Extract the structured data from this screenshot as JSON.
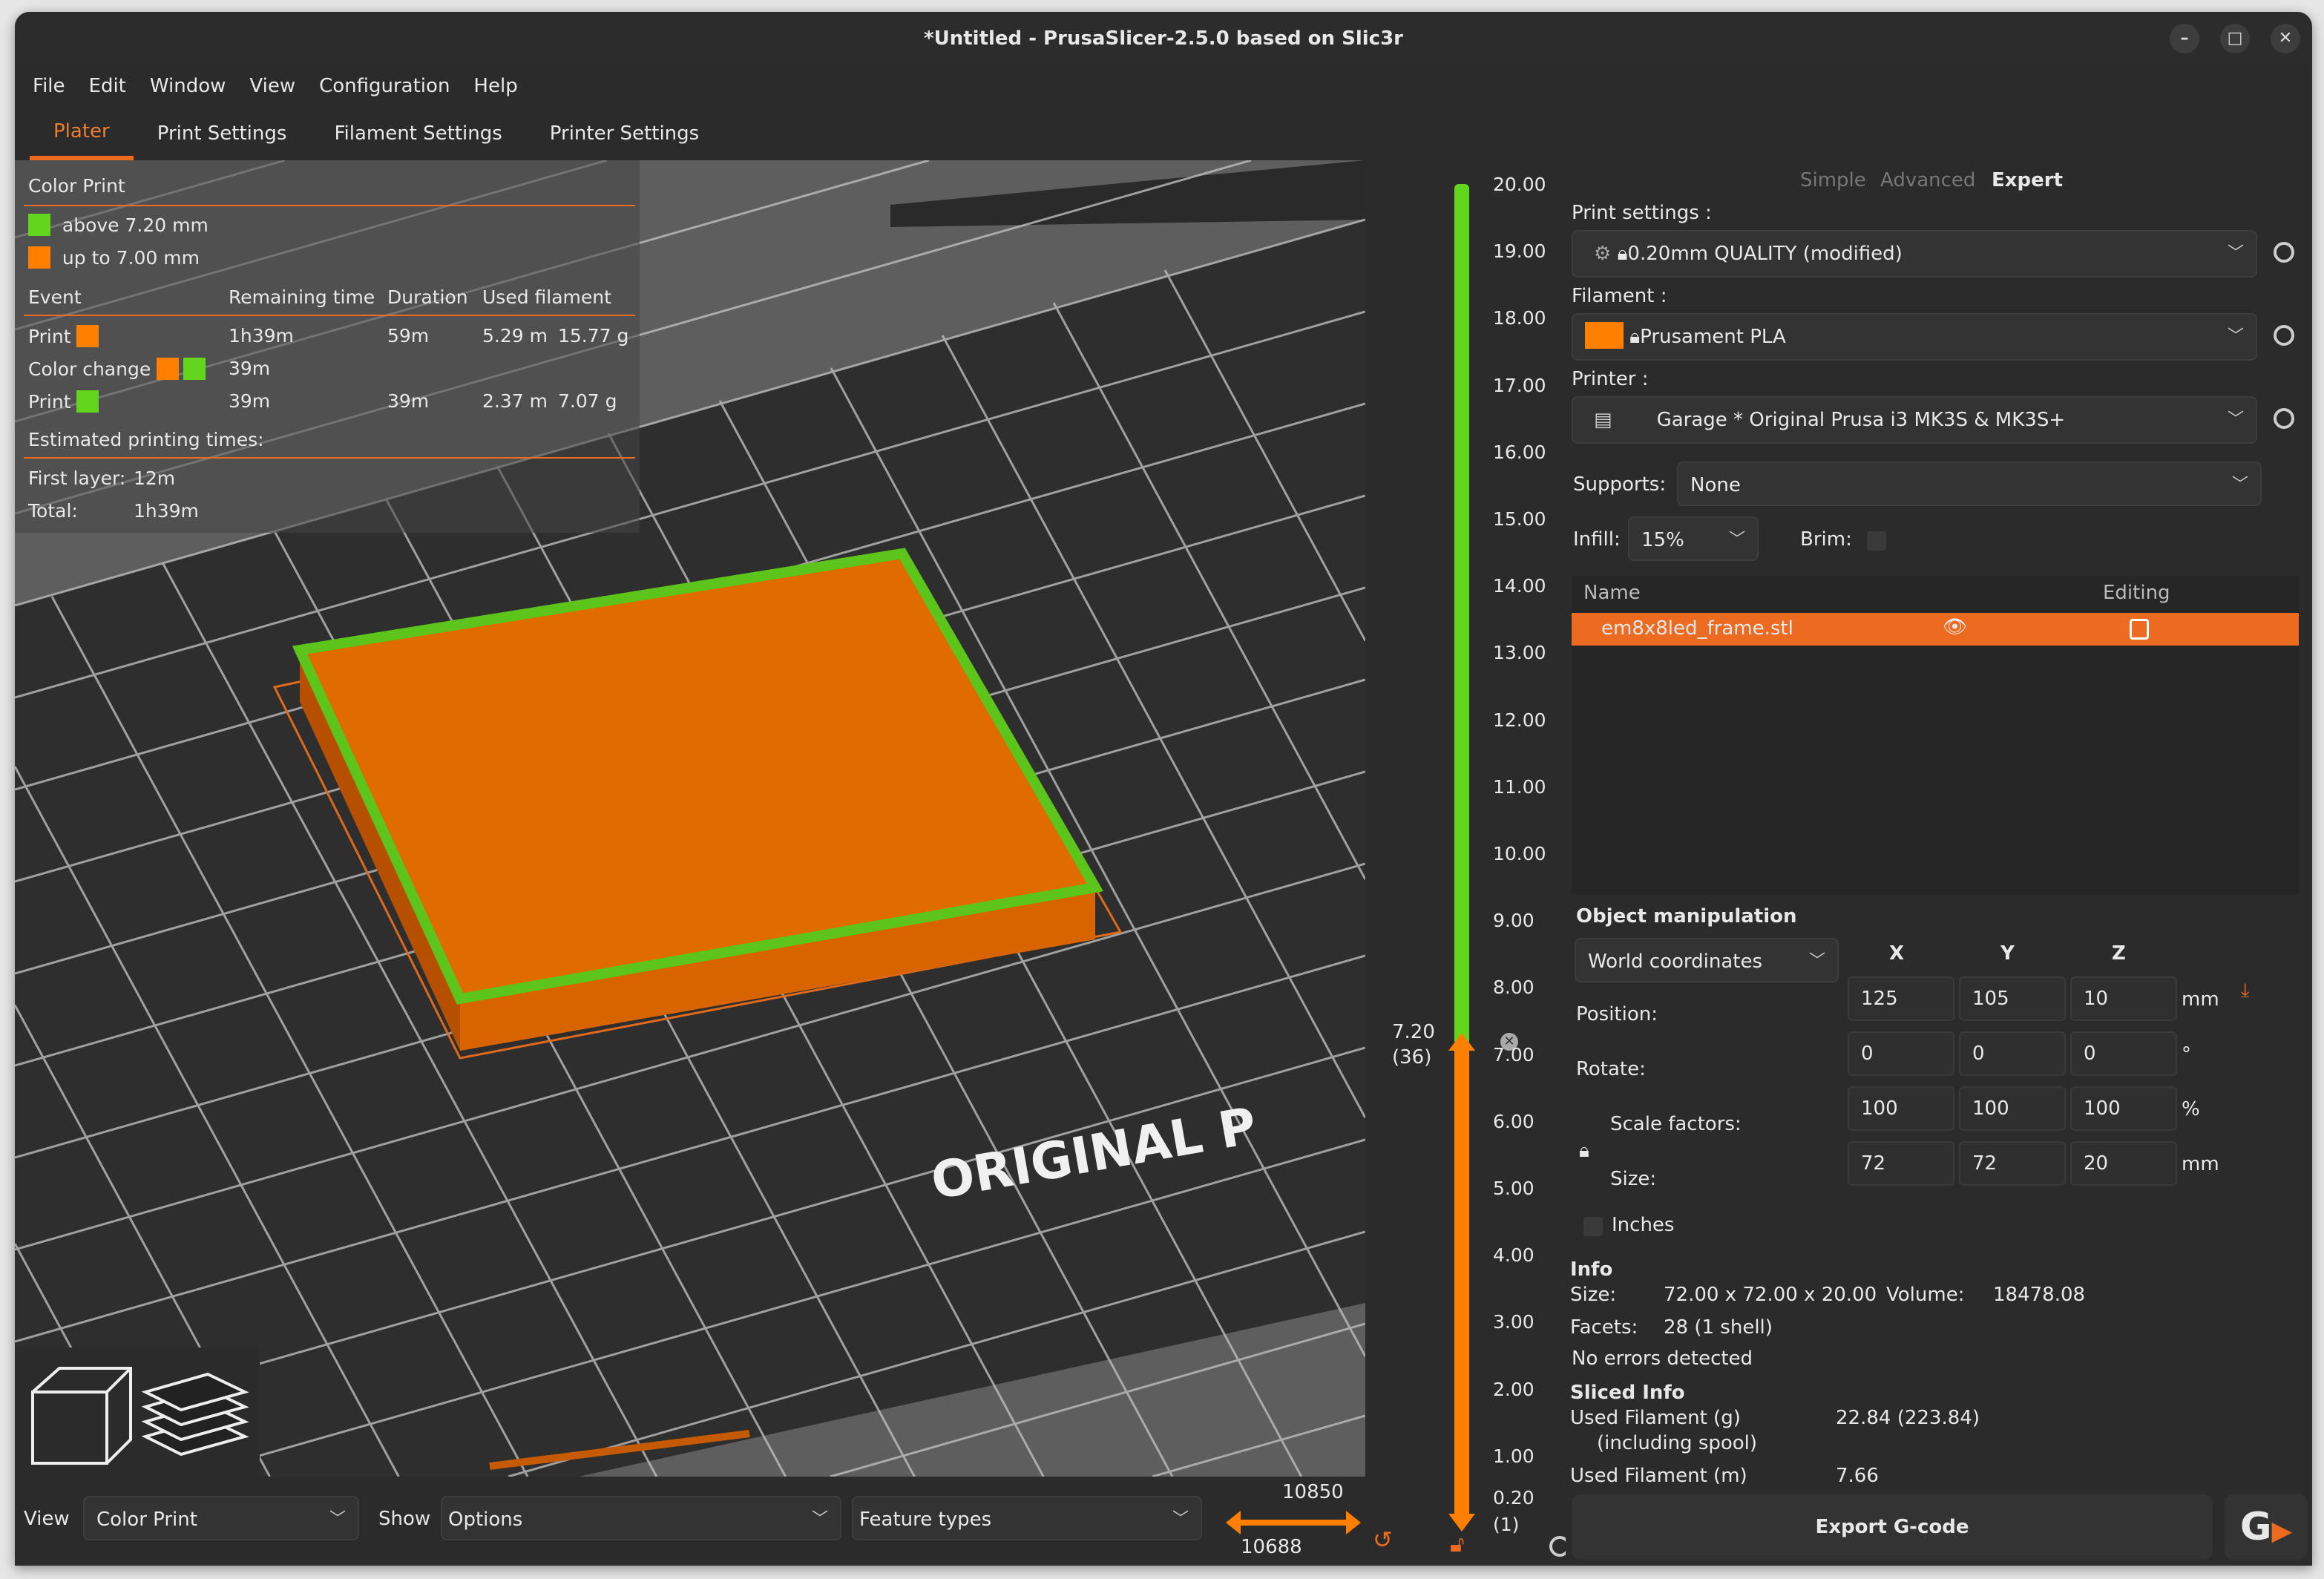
{
  "window": {
    "title": "*Untitled - PrusaSlicer-2.5.0 based on Slic3r",
    "minimize": "–",
    "maximize": "□",
    "close": "✕"
  },
  "menu": [
    "File",
    "Edit",
    "Window",
    "View",
    "Configuration",
    "Help"
  ],
  "tabs": [
    "Plater",
    "Print Settings",
    "Filament Settings",
    "Printer Settings"
  ],
  "legend": {
    "title": "Color Print",
    "items": [
      {
        "label": "above 7.20 mm",
        "color": "#63d51c"
      },
      {
        "label": "up to 7.00 mm",
        "color": "#ff7f00"
      }
    ],
    "headers": [
      "Event",
      "Remaining time",
      "Duration",
      "Used filament"
    ],
    "rows": [
      {
        "event": "Print",
        "remaining": "1h39m",
        "duration": "59m",
        "length": "5.29 m",
        "weight": "15.77 g"
      },
      {
        "event": "Color change",
        "remaining": "39m"
      },
      {
        "event": "Print",
        "remaining": "39m",
        "duration": "39m",
        "length": "2.37 m",
        "weight": "7.07 g"
      }
    ],
    "estimated_title": "Estimated printing times:",
    "first_layer_label": "First layer:",
    "first_layer": "12m",
    "total_label": "Total:",
    "total": "1h39m"
  },
  "bed_text": "ORIGINAL P",
  "layer_slider": {
    "ticks": [
      "20.00",
      "19.00",
      "18.00",
      "17.00",
      "16.00",
      "15.00",
      "14.00",
      "13.00",
      "12.00",
      "11.00",
      "10.00",
      "9.00",
      "8.00",
      "7.00",
      "6.00",
      "5.00",
      "4.00",
      "3.00",
      "2.00",
      "1.00",
      "0.20"
    ],
    "current": "7.20",
    "current_layer": "(36)",
    "bottom_layer": "(1)",
    "upper_color": "#63d51c",
    "lower_color": "#ff7f00"
  },
  "bottom": {
    "view_label": "View",
    "view_value": "Color Print",
    "show_label": "Show",
    "show_value": "Options",
    "feature_value": "Feature types",
    "moves_top": "10850",
    "moves_bottom": "10688"
  },
  "panel": {
    "modes": [
      "Simple",
      "Advanced",
      "Expert"
    ],
    "print_label": "Print settings :",
    "print_value": "0.20mm QUALITY (modified)",
    "filament_label": "Filament :",
    "filament_value": "Prusament PLA",
    "filament_color": "#ff7f00",
    "printer_label": "Printer :",
    "printer_value": "Garage * Original Prusa i3 MK3S & MK3S+",
    "supports_label": "Supports:",
    "supports_value": "None",
    "infill_label": "Infill:",
    "infill_value": "15%",
    "brim_label": "Brim:",
    "list_headers": [
      "Name",
      "Editing"
    ],
    "object": "em8x8led_frame.stl",
    "om": {
      "title": "Object manipulation",
      "coords": "World coordinates",
      "axes": [
        "X",
        "Y",
        "Z"
      ],
      "position_label": "Position:",
      "position": [
        "125",
        "105",
        "10"
      ],
      "position_unit": "mm",
      "rotate_label": "Rotate:",
      "rotate": [
        "0",
        "0",
        "0"
      ],
      "rotate_unit": "°",
      "scale_label": "Scale factors:",
      "scale": [
        "100",
        "100",
        "100"
      ],
      "scale_unit": "%",
      "size_label": "Size:",
      "size": [
        "72",
        "72",
        "20"
      ],
      "size_unit": "mm",
      "inches": "Inches"
    },
    "info": {
      "title": "Info",
      "size_label": "Size:",
      "size": "72.00 x 72.00 x 20.00",
      "volume_label": "Volume:",
      "volume": "18478.08",
      "facets_label": "Facets:",
      "facets": "28 (1 shell)",
      "errors": "No errors detected"
    },
    "sliced": {
      "title": "Sliced Info",
      "g_label": "Used Filament (g)",
      "g_sub": "(including spool)",
      "g_value": "22.84 (223.84)",
      "m_label": "Used Filament (m)",
      "m_value": "7.66"
    },
    "export": "Export G-code"
  },
  "accent": "#ed6b21"
}
